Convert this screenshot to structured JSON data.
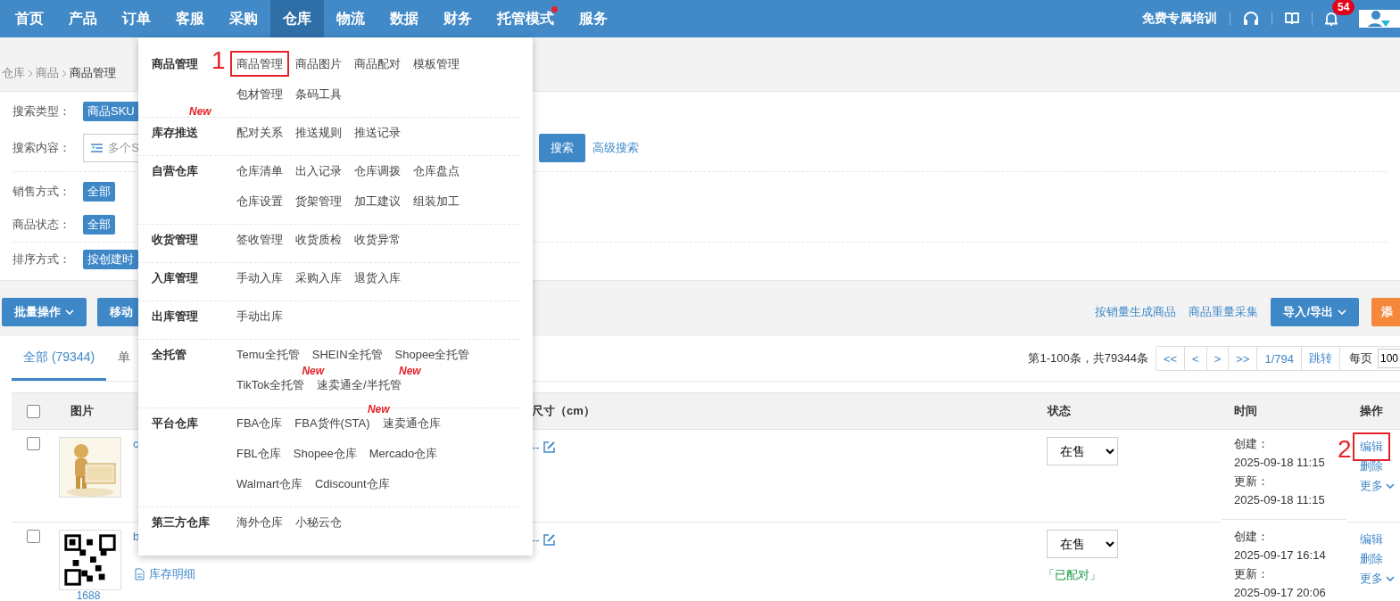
{
  "nav": {
    "items": [
      {
        "label": "首页",
        "selected": false,
        "dot": false
      },
      {
        "label": "产品",
        "selected": false,
        "dot": false
      },
      {
        "label": "订单",
        "selected": false,
        "dot": false
      },
      {
        "label": "客服",
        "selected": false,
        "dot": false
      },
      {
        "label": "采购",
        "selected": false,
        "dot": false
      },
      {
        "label": "仓库",
        "selected": true,
        "dot": false
      },
      {
        "label": "物流",
        "selected": false,
        "dot": false
      },
      {
        "label": "数据",
        "selected": false,
        "dot": false
      },
      {
        "label": "财务",
        "selected": false,
        "dot": false
      },
      {
        "label": "托管模式",
        "selected": false,
        "dot": true
      },
      {
        "label": "服务",
        "selected": false,
        "dot": false
      }
    ],
    "training_link": "免费专属培训",
    "notification_count": "54"
  },
  "breadcrumb": [
    "仓库",
    "商品",
    "商品管理"
  ],
  "filter_groups": [
    [
      {
        "kind": "tag",
        "label": "搜索类型：",
        "value": "商品SKU"
      },
      {
        "kind": "input",
        "label": "搜索内容：",
        "placeholder": "多个S"
      }
    ],
    [
      {
        "kind": "tag",
        "label": "销售方式：",
        "value": "全部"
      },
      {
        "kind": "tag",
        "label": "商品状态：",
        "value": "全部"
      }
    ],
    [
      {
        "kind": "tag",
        "label": "排序方式：",
        "value": "按创建时"
      }
    ]
  ],
  "search_button": "搜索",
  "advanced_search": "高级搜索",
  "toolbar": {
    "left": [
      {
        "label": "批量操作",
        "dropdown": true
      },
      {
        "label": "移动",
        "dropdown": false
      }
    ],
    "links": [
      "按销量生成商品",
      "商品重量采集"
    ],
    "right": [
      {
        "label": "导入/导出",
        "kind": "primary",
        "dropdown": true
      },
      {
        "label": "添",
        "kind": "accent",
        "dropdown": false
      }
    ]
  },
  "tabs": [
    {
      "label": "全部 (79344)",
      "selected": true
    },
    {
      "label": "单",
      "selected": false
    }
  ],
  "pager": {
    "summary": "第1-100条，共79344条",
    "buttons": [
      "<<",
      "<",
      ">",
      ">>",
      "1/794",
      "跳转"
    ],
    "per_page_label": "每页",
    "per_page": "100"
  },
  "table": {
    "header_checked": false,
    "columns": [
      "图片",
      "尺寸（cm）",
      "状态",
      "时间",
      "操作"
    ],
    "rows": [
      {
        "checked": false,
        "name": "c",
        "size": "--",
        "status": "在售",
        "created_label": "创建：",
        "created": "2025-09-18 11:15",
        "updated_label": "更新：",
        "updated": "2025-09-18 11:15",
        "actions": [
          {
            "label": "编辑",
            "dropdown": false,
            "highlighted": true,
            "annotation": "2"
          },
          {
            "label": "删除",
            "dropdown": false,
            "highlighted": false
          },
          {
            "label": "更多",
            "dropdown": true,
            "highlighted": false
          }
        ]
      },
      {
        "checked": false,
        "name": "b",
        "picture_link": "1688",
        "stock_link": "库存明细",
        "size": "--",
        "status": "在售",
        "match_tag": "「已配对」",
        "created_label": "创建：",
        "created": "2025-09-17 16:14",
        "updated_label": "更新：",
        "updated": "2025-09-17 20:06",
        "actions": [
          {
            "label": "编辑",
            "dropdown": false,
            "highlighted": false
          },
          {
            "label": "删除",
            "dropdown": false,
            "highlighted": false
          },
          {
            "label": "更多",
            "dropdown": true,
            "highlighted": false
          }
        ]
      }
    ]
  },
  "menu": {
    "sections": [
      {
        "title": "商品管理",
        "rows": [
          [
            {
              "label": "商品管理",
              "highlighted": true,
              "annotation": "1"
            },
            {
              "label": "商品图片",
              "highlighted": false
            },
            {
              "label": "商品配对",
              "highlighted": false
            },
            {
              "label": "模板管理",
              "highlighted": false
            }
          ],
          [
            {
              "label": "包材管理",
              "highlighted": false
            },
            {
              "label": "条码工具",
              "highlighted": false
            }
          ]
        ]
      },
      {
        "title": "库存推送",
        "badge": "New",
        "rows": [
          [
            {
              "label": "配对关系",
              "highlighted": false
            },
            {
              "label": "推送规则",
              "highlighted": false
            },
            {
              "label": "推送记录",
              "highlighted": false
            }
          ]
        ]
      },
      {
        "title": "自营仓库",
        "rows": [
          [
            {
              "label": "仓库清单",
              "highlighted": false
            },
            {
              "label": "出入记录",
              "highlighted": false
            },
            {
              "label": "仓库调拨",
              "highlighted": false
            },
            {
              "label": "仓库盘点",
              "highlighted": false
            }
          ],
          [
            {
              "label": "仓库设置",
              "highlighted": false
            },
            {
              "label": "货架管理",
              "highlighted": false
            },
            {
              "label": "加工建议",
              "highlighted": false
            },
            {
              "label": "组装加工",
              "highlighted": false
            }
          ]
        ]
      },
      {
        "title": "收货管理",
        "rows": [
          [
            {
              "label": "签收管理",
              "highlighted": false
            },
            {
              "label": "收货质检",
              "highlighted": false
            },
            {
              "label": "收货异常",
              "highlighted": false
            }
          ]
        ]
      },
      {
        "title": "入库管理",
        "rows": [
          [
            {
              "label": "手动入库",
              "highlighted": false
            },
            {
              "label": "采购入库",
              "highlighted": false
            },
            {
              "label": "退货入库",
              "highlighted": false
            }
          ]
        ]
      },
      {
        "title": "出库管理",
        "rows": [
          [
            {
              "label": "手动出库",
              "highlighted": false
            }
          ]
        ]
      },
      {
        "title": "全托管",
        "rows": [
          [
            {
              "label": "Temu全托管",
              "highlighted": false
            },
            {
              "label": "SHEIN全托管",
              "highlighted": false
            },
            {
              "label": "Shopee全托管",
              "highlighted": false
            }
          ],
          [
            {
              "label": "TikTok全托管",
              "badge": "New",
              "highlighted": false
            },
            {
              "label": "速卖通全/半托管",
              "badge": "New",
              "highlighted": false
            }
          ]
        ]
      },
      {
        "title": "平台仓库",
        "rows": [
          [
            {
              "label": "FBA仓库",
              "highlighted": false
            },
            {
              "label": "FBA货件(STA)",
              "badge": "New",
              "highlighted": false
            },
            {
              "label": "速卖通仓库",
              "highlighted": false
            }
          ],
          [
            {
              "label": "FBL仓库",
              "highlighted": false
            },
            {
              "label": "Shopee仓库",
              "highlighted": false
            },
            {
              "label": "Mercado仓库",
              "highlighted": false
            }
          ],
          [
            {
              "label": "Walmart仓库",
              "highlighted": false
            },
            {
              "label": "Cdiscount仓库",
              "highlighted": false
            }
          ]
        ]
      },
      {
        "title": "第三方仓库",
        "rows": [
          [
            {
              "label": "海外仓库",
              "highlighted": false
            },
            {
              "label": "小秘云仓",
              "highlighted": false
            }
          ]
        ]
      }
    ]
  }
}
